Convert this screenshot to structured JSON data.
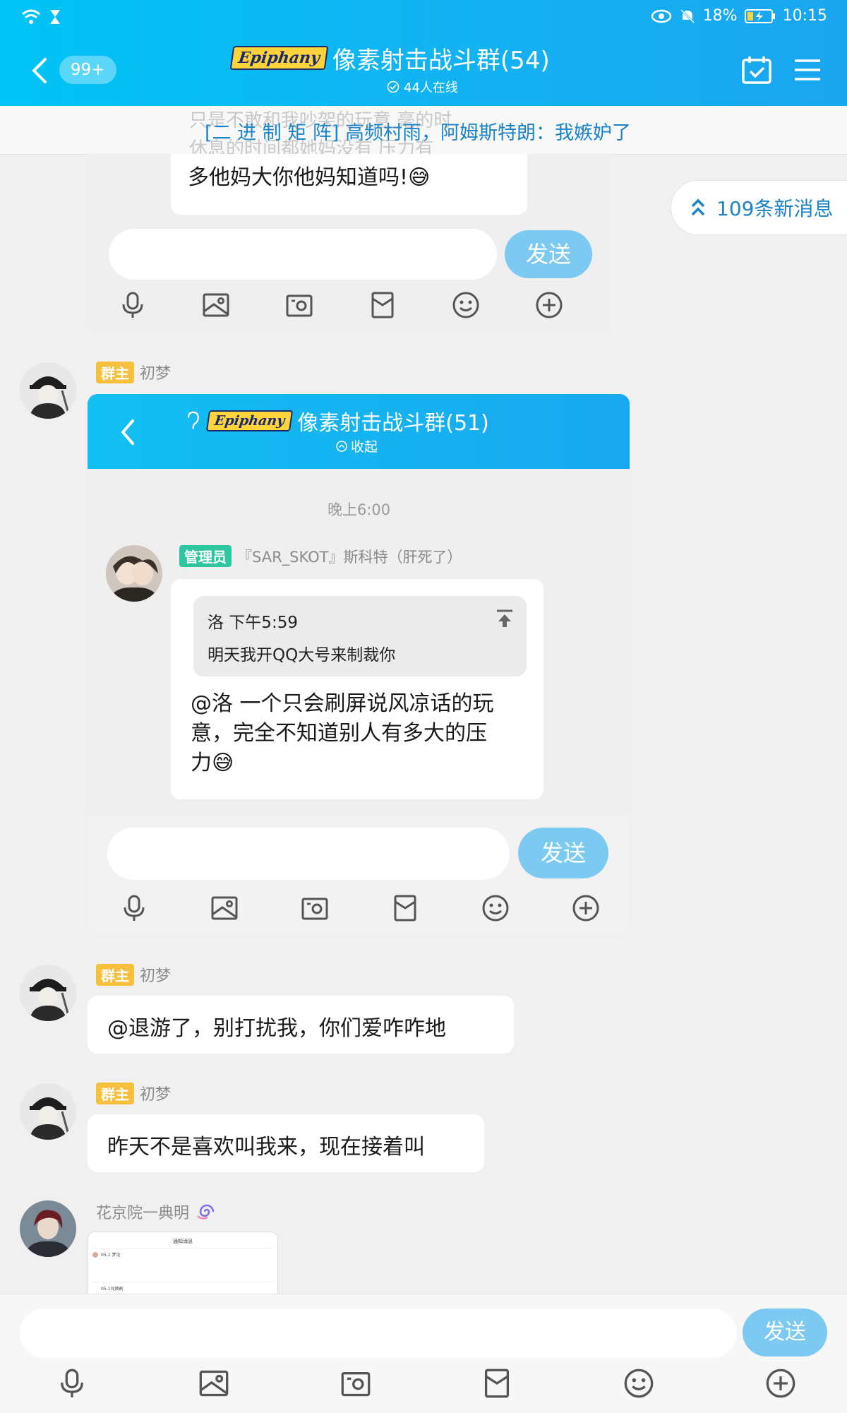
{
  "status_bar": {
    "battery": "18%",
    "time": "10:15"
  },
  "header": {
    "unread_badge": "99+",
    "brand": "Epiphany",
    "title": "像素射击战斗群(54)",
    "online": "44人在线"
  },
  "notice": {
    "ghost_line1": "只是不敢和我吵架的玩意 毫的时",
    "ghost_line2": "休息的时间都她妈没有 压力有",
    "text": "[二 进 制 矩 阵] 高频村雨，阿姆斯特朗：我嫉妒了"
  },
  "new_messages": {
    "label": "109条新消息"
  },
  "shot1": {
    "partial_text": "多他妈大你他妈知道吗!😅",
    "send_label": "发送"
  },
  "msg_owner_1": {
    "badge": "群主",
    "name": "初梦"
  },
  "shot2": {
    "brand": "Epiphany",
    "title": "像素射击战斗群(51)",
    "collapse_label": "收起",
    "time": "晚上6:00",
    "admin_badge": "管理员",
    "admin_name": "『SAR_SKOT』斯科特（肝死了）",
    "quote_author": "洛  下午5:59",
    "quote_text": "明天我开QQ大号来制裁你",
    "reply_line1": "@洛 一个只会刷屏说风凉话的玩",
    "reply_line2": "意，完全不知道别人有多大的压",
    "reply_line3": "力😅",
    "send_label": "发送"
  },
  "msg_owner_2": {
    "badge": "群主",
    "name": "初梦",
    "text": "@退游了，别打扰我，你们爱咋咋地"
  },
  "msg_owner_3": {
    "badge": "群主",
    "name": "初梦",
    "text": "昨天不是喜欢叫我来，现在接着叫"
  },
  "msg_member": {
    "name": "花京院一典明",
    "thumb_title": "通知消息",
    "thumb_item1": "05-1 梦见",
    "thumb_item2": "05-1兑换刷"
  },
  "composer": {
    "send_label": "发送"
  },
  "colors": {
    "header": "#13b2f2",
    "accent": "#1b84c8",
    "send": "#7ccaf2"
  }
}
